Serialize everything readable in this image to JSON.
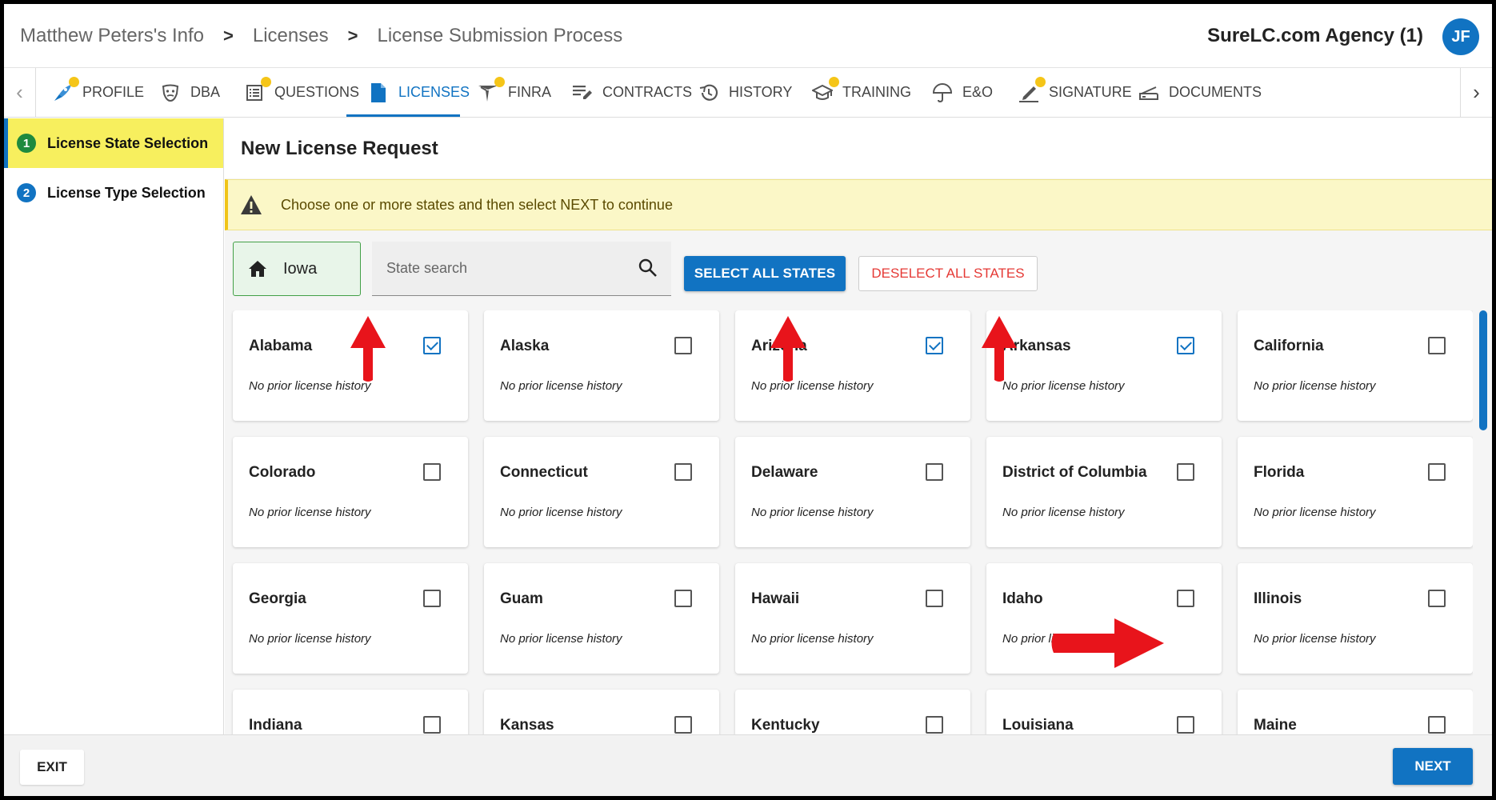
{
  "breadcrumb": [
    "Matthew Peters's Info",
    "Licenses",
    "License Submission Process"
  ],
  "agency": "SureLC.com Agency (1)",
  "avatar_initials": "JF",
  "tabs": [
    {
      "label": "PROFILE",
      "icon": "rocket-icon",
      "dot": true,
      "active": false
    },
    {
      "label": "DBA",
      "icon": "mask-icon",
      "dot": false,
      "active": false
    },
    {
      "label": "QUESTIONS",
      "icon": "list-icon",
      "dot": true,
      "active": false
    },
    {
      "label": "LICENSES",
      "icon": "document-icon",
      "dot": false,
      "active": true
    },
    {
      "label": "FINRA",
      "icon": "finra-icon",
      "dot": true,
      "active": false
    },
    {
      "label": "CONTRACTS",
      "icon": "edit-list-icon",
      "dot": false,
      "active": false
    },
    {
      "label": "HISTORY",
      "icon": "history-icon",
      "dot": false,
      "active": false
    },
    {
      "label": "TRAINING",
      "icon": "graduation-cap-icon",
      "dot": true,
      "active": false
    },
    {
      "label": "E&O",
      "icon": "umbrella-icon",
      "dot": false,
      "active": false
    },
    {
      "label": "SIGNATURE",
      "icon": "signature-icon",
      "dot": true,
      "active": false
    },
    {
      "label": "DOCUMENTS",
      "icon": "scanner-icon",
      "dot": false,
      "active": false
    }
  ],
  "steps": [
    {
      "num": "1",
      "label": "License State Selection",
      "active": true
    },
    {
      "num": "2",
      "label": "License Type Selection",
      "active": false
    }
  ],
  "main": {
    "title": "New License Request",
    "warning": "Choose one or more states and then select NEXT to continue",
    "home_state": "Iowa",
    "search_placeholder": "State search",
    "select_all_label": "SELECT ALL STATES",
    "deselect_all_label": "DESELECT ALL STATES"
  },
  "history_text": "No prior license history",
  "states": [
    {
      "name": "Alabama",
      "checked": true
    },
    {
      "name": "Alaska",
      "checked": false
    },
    {
      "name": "Arizona",
      "checked": true
    },
    {
      "name": "Arkansas",
      "checked": true
    },
    {
      "name": "California",
      "checked": false
    },
    {
      "name": "Colorado",
      "checked": false
    },
    {
      "name": "Connecticut",
      "checked": false
    },
    {
      "name": "Delaware",
      "checked": false
    },
    {
      "name": "District of Columbia",
      "checked": false
    },
    {
      "name": "Florida",
      "checked": false
    },
    {
      "name": "Georgia",
      "checked": false
    },
    {
      "name": "Guam",
      "checked": false
    },
    {
      "name": "Hawaii",
      "checked": false
    },
    {
      "name": "Idaho",
      "checked": false
    },
    {
      "name": "Illinois",
      "checked": false
    },
    {
      "name": "Indiana",
      "checked": false
    },
    {
      "name": "Kansas",
      "checked": false
    },
    {
      "name": "Kentucky",
      "checked": false
    },
    {
      "name": "Louisiana",
      "checked": false
    },
    {
      "name": "Maine",
      "checked": false
    }
  ],
  "footer": {
    "exit_label": "EXIT",
    "next_label": "NEXT"
  },
  "colors": {
    "primary": "#1173c2",
    "active_step": "#f7ef5e",
    "warning_bg": "#fbf7c7",
    "danger": "#e53935",
    "annotation_arrow": "#e8141b",
    "tab_dot": "#f5c518"
  }
}
